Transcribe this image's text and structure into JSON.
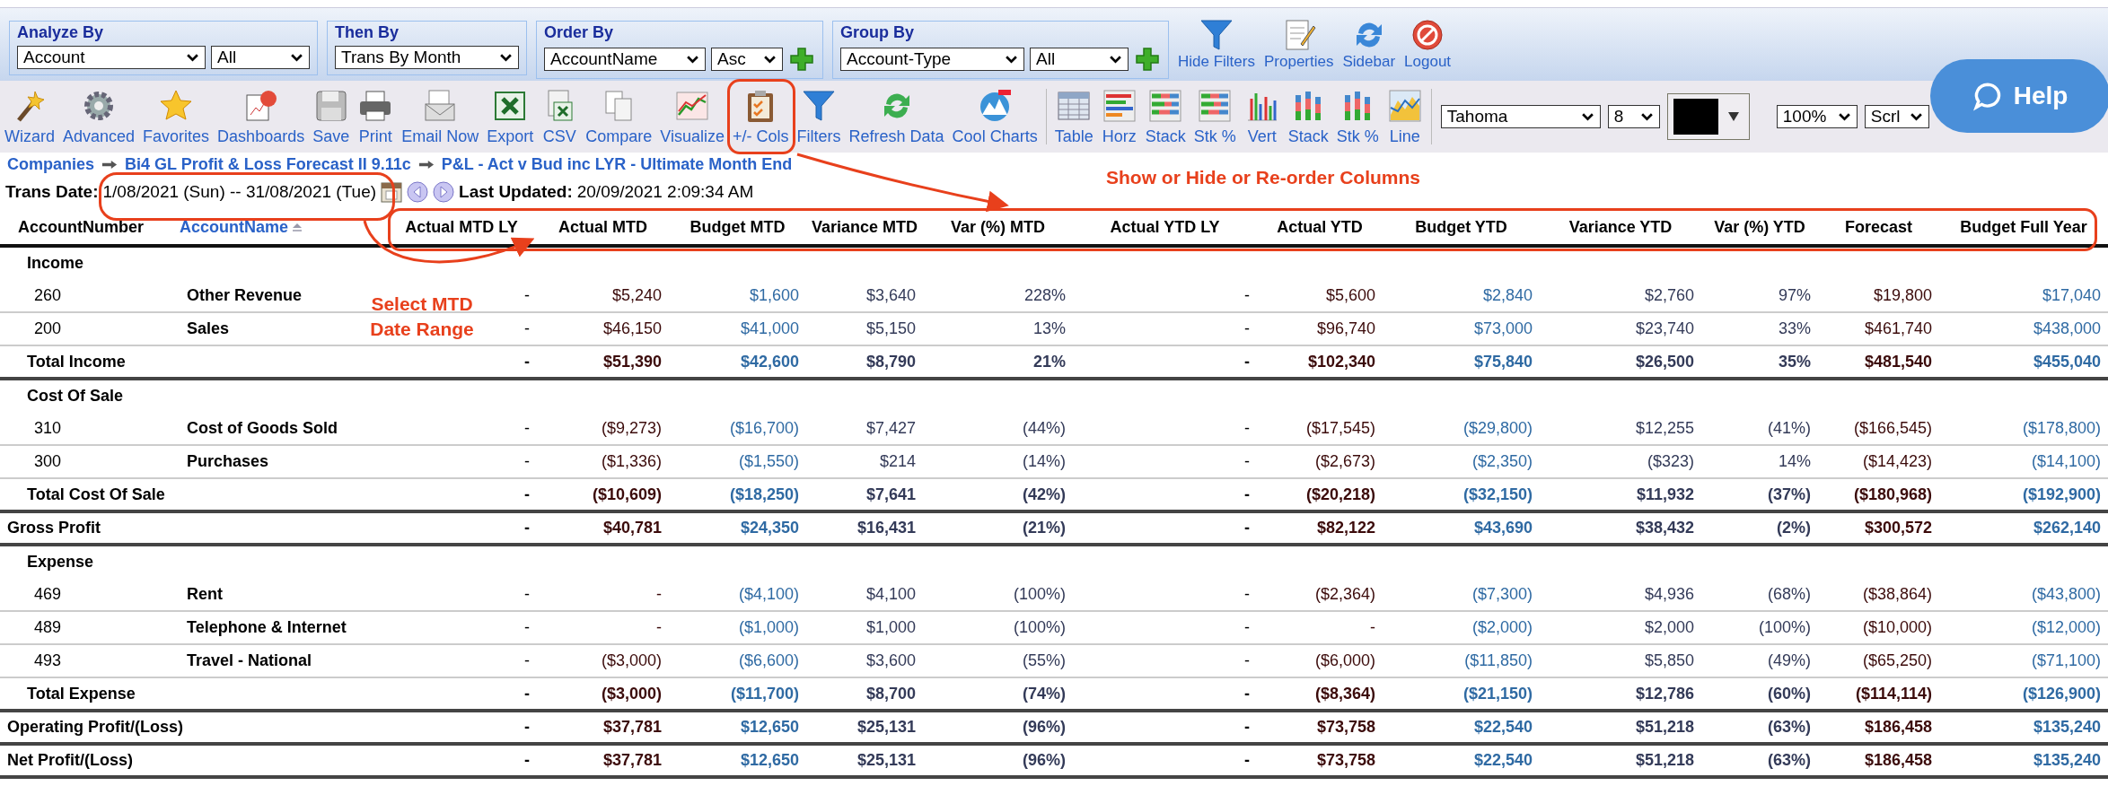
{
  "filter_groups": [
    {
      "title": "Analyze By",
      "selects": [
        "Account",
        "All"
      ],
      "add_button": false
    },
    {
      "title": "Then By",
      "selects": [
        "Trans By Month"
      ],
      "add_button": false
    },
    {
      "title": "Order By",
      "selects": [
        "AccountName",
        "Asc"
      ],
      "add_button": true
    },
    {
      "title": "Group By",
      "selects": [
        "Account-Type",
        "All"
      ],
      "add_button": true
    }
  ],
  "top_actions": [
    {
      "label": "Hide Filters",
      "kind": "funnel"
    },
    {
      "label": "Properties",
      "kind": "notepad"
    },
    {
      "label": "Sidebar",
      "kind": "refresh"
    },
    {
      "label": "Logout",
      "kind": "noentry"
    }
  ],
  "tools": [
    {
      "label": "Wizard",
      "kind": "wand"
    },
    {
      "label": "Advanced",
      "kind": "gear"
    },
    {
      "label": "Favorites",
      "kind": "star"
    },
    {
      "label": "Dashboards",
      "kind": "board"
    },
    {
      "label": "Save",
      "kind": "floppy"
    },
    {
      "label": "Print",
      "kind": "printer"
    },
    {
      "label": "Email Now",
      "kind": "envelope"
    },
    {
      "label": "Export",
      "kind": "excel"
    },
    {
      "label": "CSV",
      "kind": "csv"
    },
    {
      "label": "Compare",
      "kind": "docs"
    },
    {
      "label": "Visualize",
      "kind": "linechart"
    },
    {
      "label": "+/- Cols",
      "kind": "clipboard"
    },
    {
      "label": "Filters",
      "kind": "funnel"
    },
    {
      "label": "Refresh Data",
      "kind": "refresh"
    },
    {
      "label": "Cool Charts",
      "kind": "cloud"
    }
  ],
  "chart_tools": [
    {
      "label": "Table",
      "kind": "table"
    },
    {
      "label": "Horz",
      "kind": "horz"
    },
    {
      "label": "Stack",
      "kind": "hstack"
    },
    {
      "label": "Stk %",
      "kind": "hstack"
    },
    {
      "label": "Vert",
      "kind": "vert"
    },
    {
      "label": "Stack",
      "kind": "vstack"
    },
    {
      "label": "Stk %",
      "kind": "vstack"
    },
    {
      "label": "Line",
      "kind": "area"
    }
  ],
  "font": {
    "family": "Tahoma",
    "size": "8"
  },
  "zoom": "100%",
  "scroll": "Scrl",
  "help": "Help",
  "breadcrumb": [
    "Companies",
    "Bi4 GL Profit & Loss Forecast II 9.11c",
    "P&L - Act v Bud inc LYR - Ultimate Month End"
  ],
  "trans_date": {
    "label": "Trans Date:",
    "value": "1/08/2021 (Sun) -- 31/08/2021 (Tue)",
    "updated_label": "Last Updated:",
    "updated_value": "20/09/2021 2:09:34 AM"
  },
  "table": {
    "columns": [
      "AccountNumber",
      "AccountName",
      "Actual MTD LY",
      "Actual MTD",
      "Budget MTD",
      "Variance MTD",
      "Var (%) MTD",
      "Actual YTD LY",
      "Actual YTD",
      "Budget YTD",
      "Variance YTD",
      "Var (%) YTD",
      "Forecast",
      "Budget Full Year"
    ],
    "rows": [
      {
        "kind": "section",
        "label": "Income"
      },
      {
        "kind": "item",
        "number": "260",
        "name": "Other Revenue",
        "values": [
          "-",
          "$5,240",
          "$1,600",
          "$3,640",
          "228%",
          "-",
          "$5,600",
          "$2,840",
          "$2,760",
          "97%",
          "$19,800",
          "$17,040"
        ]
      },
      {
        "kind": "item",
        "number": "200",
        "name": "Sales",
        "values": [
          "-",
          "$46,150",
          "$41,000",
          "$5,150",
          "13%",
          "-",
          "$96,740",
          "$73,000",
          "$23,740",
          "33%",
          "$461,740",
          "$438,000"
        ]
      },
      {
        "kind": "total",
        "label": "Total Income",
        "values": [
          "-",
          "$51,390",
          "$42,600",
          "$8,790",
          "21%",
          "-",
          "$102,340",
          "$75,840",
          "$26,500",
          "35%",
          "$481,540",
          "$455,040"
        ]
      },
      {
        "kind": "section",
        "label": "Cost Of Sale"
      },
      {
        "kind": "item",
        "number": "310",
        "name": "Cost of Goods Sold",
        "values": [
          "-",
          "($9,273)",
          "($16,700)",
          "$7,427",
          "(44%)",
          "-",
          "($17,545)",
          "($29,800)",
          "$12,255",
          "(41%)",
          "($166,545)",
          "($178,800)"
        ]
      },
      {
        "kind": "item",
        "number": "300",
        "name": "Purchases",
        "values": [
          "-",
          "($1,336)",
          "($1,550)",
          "$214",
          "(14%)",
          "-",
          "($2,673)",
          "($2,350)",
          "($323)",
          "14%",
          "($14,423)",
          "($14,100)"
        ]
      },
      {
        "kind": "total",
        "label": "Total Cost Of Sale",
        "values": [
          "-",
          "($10,609)",
          "($18,250)",
          "$7,641",
          "(42%)",
          "-",
          "($20,218)",
          "($32,150)",
          "$11,932",
          "(37%)",
          "($180,968)",
          "($192,900)"
        ]
      },
      {
        "kind": "grand",
        "label": "Gross Profit",
        "values": [
          "-",
          "$40,781",
          "$24,350",
          "$16,431",
          "(21%)",
          "-",
          "$82,122",
          "$43,690",
          "$38,432",
          "(2%)",
          "$300,572",
          "$262,140"
        ]
      },
      {
        "kind": "section",
        "label": "Expense"
      },
      {
        "kind": "item",
        "number": "469",
        "name": "Rent",
        "values": [
          "-",
          "-",
          "($4,100)",
          "$4,100",
          "(100%)",
          "-",
          "($2,364)",
          "($7,300)",
          "$4,936",
          "(68%)",
          "($38,864)",
          "($43,800)"
        ]
      },
      {
        "kind": "item",
        "number": "489",
        "name": "Telephone & Internet",
        "values": [
          "-",
          "-",
          "($1,000)",
          "$1,000",
          "(100%)",
          "-",
          "-",
          "($2,000)",
          "$2,000",
          "(100%)",
          "($10,000)",
          "($12,000)"
        ]
      },
      {
        "kind": "item",
        "number": "493",
        "name": "Travel - National",
        "values": [
          "-",
          "($3,000)",
          "($6,600)",
          "$3,600",
          "(55%)",
          "-",
          "($6,000)",
          "($11,850)",
          "$5,850",
          "(49%)",
          "($65,250)",
          "($71,100)"
        ]
      },
      {
        "kind": "total",
        "label": "Total Expense",
        "values": [
          "-",
          "($3,000)",
          "($11,700)",
          "$8,700",
          "(74%)",
          "-",
          "($8,364)",
          "($21,150)",
          "$12,786",
          "(60%)",
          "($114,114)",
          "($126,900)"
        ]
      },
      {
        "kind": "grand",
        "label": "Operating Profit/(Loss)",
        "values": [
          "-",
          "$37,781",
          "$12,650",
          "$25,131",
          "(96%)",
          "-",
          "$73,758",
          "$22,540",
          "$51,218",
          "(63%)",
          "$186,458",
          "$135,240"
        ]
      },
      {
        "kind": "grand",
        "label": "Net Profit/(Loss)",
        "values": [
          "-",
          "$37,781",
          "$12,650",
          "$25,131",
          "(96%)",
          "-",
          "$73,758",
          "$22,540",
          "$51,218",
          "(63%)",
          "$186,458",
          "$135,240"
        ]
      }
    ]
  },
  "annotations": [
    "Show or Hide or Re-order Columns",
    "Select MTD Date Range"
  ]
}
